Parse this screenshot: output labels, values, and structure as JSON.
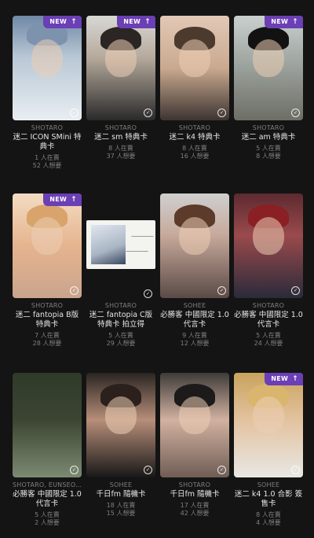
{
  "cards": [
    {
      "author": "SHOTARO",
      "title": "迷二 ICON SMini 特典卡",
      "have": "1 人在賣",
      "want": "52 人想要",
      "new": true
    },
    {
      "author": "SHOTARO",
      "title": "迷二 sm 特典卡",
      "have": "8 人在賣",
      "want": "37 人想要",
      "new": true
    },
    {
      "author": "SHOTARO",
      "title": "迷二 k4 特典卡",
      "have": "8 人在賣",
      "want": "16 人想要",
      "new": false
    },
    {
      "author": "SHOTARO",
      "title": "迷二 am 特典卡",
      "have": "5 人在賣",
      "want": "8 人想要",
      "new": true
    },
    {
      "author": "SHOTARO",
      "title": "迷二 fantopia B版 特典卡",
      "have": "7 人在賣",
      "want": "28 人想要",
      "new": true
    },
    {
      "author": "SHOTARO",
      "title": "迷二 fantopia C版 特典卡 拍立得",
      "have": "5 人在賣",
      "want": "29 人想要",
      "new": false
    },
    {
      "author": "SOHEE",
      "title": "必勝客 中國限定 1.0 代言卡",
      "have": "9 人在賣",
      "want": "12 人想要",
      "new": false
    },
    {
      "author": "SHOTARO",
      "title": "必勝客 中國限定 1.0 代言卡",
      "have": "5 人在賣",
      "want": "24 人想要",
      "new": false
    },
    {
      "author": "SHOTARO, EUNSEO...",
      "title": "必勝客 中國限定 1.0 代言卡",
      "have": "5 人在賣",
      "want": "2 人想要",
      "new": false
    },
    {
      "author": "SOHEE",
      "title": "千日fm 隨機卡",
      "have": "18 人在賣",
      "want": "15 人想要",
      "new": false
    },
    {
      "author": "SHOTARO",
      "title": "千日fm 隨機卡",
      "have": "17 人在賣",
      "want": "42 人想要",
      "new": false
    },
    {
      "author": "SOHEE",
      "title": "迷二 k4 1.0 合影 簽售卡",
      "have": "8 人在賣",
      "want": "4 人想要",
      "new": true
    }
  ],
  "badge": {
    "label": "NEW",
    "arrow": "↑"
  },
  "check_glyph": "✓",
  "icons": {
    "check": "check-circle-icon",
    "new": "arrow-up-icon"
  }
}
